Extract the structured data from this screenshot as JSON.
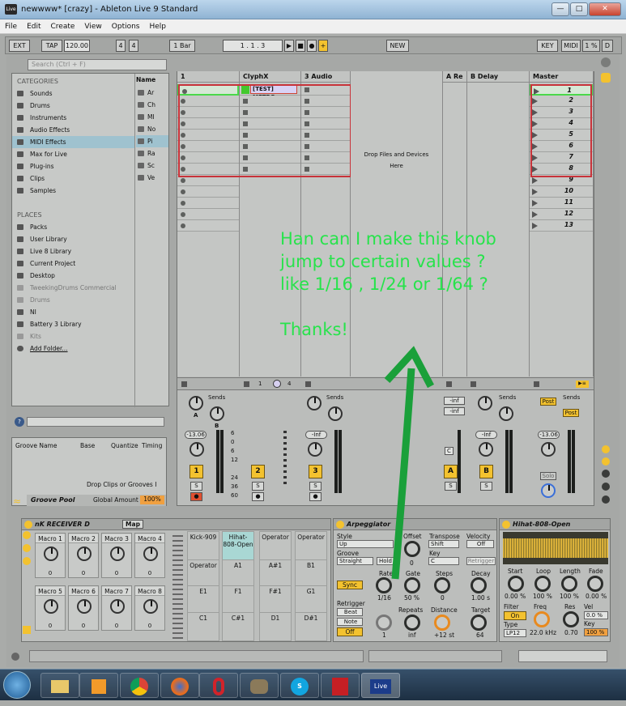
{
  "window": {
    "title": "newwww* [crazy] - Ableton Live 9 Standard",
    "app_icon": "Live",
    "minimize": "—",
    "maximize": "□",
    "close": "✕"
  },
  "menu": [
    "File",
    "Edit",
    "Create",
    "View",
    "Options",
    "Help"
  ],
  "toolbar": {
    "ext": "EXT",
    "tap": "TAP",
    "tempo": "120.00",
    "signature_num": "4",
    "signature_den": "4",
    "quantize": "1 Bar",
    "position": "1 .  1 .  3",
    "new": "NEW",
    "key": "KEY",
    "midi": "MIDI",
    "cpu": "1 %",
    "disk": "D"
  },
  "browser": {
    "search_placeholder": "Search (Ctrl + F)",
    "categories_title": "CATEGORIES",
    "categories": [
      "Sounds",
      "Drums",
      "Instruments",
      "Audio Effects",
      "MIDI Effects",
      "Max for Live",
      "Plug-ins",
      "Clips",
      "Samples"
    ],
    "selected": "MIDI Effects",
    "places_title": "PLACES",
    "places": [
      "Packs",
      "User Library",
      "Live 8 Library",
      "Current Project",
      "Desktop",
      "TweekingDrums Commercial",
      "Drums",
      "NI",
      "Battery 3 Library",
      "Kits",
      "Add Folder..."
    ],
    "name_header": "Name",
    "names": [
      "Ar",
      "Ch",
      "MI",
      "No",
      "Pi",
      "Ra",
      "Sc",
      "Ve"
    ]
  },
  "groove": {
    "headers": [
      "Groove Name",
      "Base",
      "Quantize",
      "Timing"
    ],
    "hint": "Drop Clips or Grooves I",
    "pool": "Groove Pool",
    "global_amount_label": "Global Amount",
    "global_amount": "100%"
  },
  "session": {
    "tracks": [
      {
        "name": "1",
        "number": "1",
        "volume": "-13.06",
        "sends": "Sends"
      },
      {
        "name": "ClyphX",
        "number": "2",
        "clip": "[TEST] METRO"
      },
      {
        "name": "3 Audio",
        "number": "3",
        "volume": "-Inf",
        "sends": "Sends"
      },
      {
        "name": "A Re",
        "number": "A",
        "send1": "-inf",
        "send2": "-inf",
        "c": "C"
      },
      {
        "name": "B Delay",
        "number": "B",
        "volume": "-Inf",
        "sends": "Sends"
      },
      {
        "name": "Master",
        "volume": "-13.06",
        "sends": "Sends",
        "post1": "Post",
        "post2": "Post",
        "solo": "Solo"
      }
    ],
    "drop_text": "Drop Files and Devices Here",
    "scenes": [
      "1",
      "2",
      "3",
      "4",
      "5",
      "6",
      "7",
      "8",
      "9",
      "10",
      "11",
      "12",
      "13"
    ],
    "clyphx_io": [
      "1",
      "4"
    ],
    "send_knob_labels": [
      "A",
      "B"
    ],
    "meter_scale": [
      "6",
      "0",
      "6",
      "12",
      "24",
      "36",
      "60"
    ]
  },
  "devices": {
    "receiver": {
      "title": "nK RECEIVER D",
      "map": "Map",
      "macros": [
        {
          "label": "Macro 1",
          "value": "0"
        },
        {
          "label": "Macro 2",
          "value": "0"
        },
        {
          "label": "Macro 3",
          "value": "0"
        },
        {
          "label": "Macro 4",
          "value": "0"
        },
        {
          "label": "Macro 5",
          "value": "0"
        },
        {
          "label": "Macro 6",
          "value": "0"
        },
        {
          "label": "Macro 7",
          "value": "0"
        },
        {
          "label": "Macro 8",
          "value": "0"
        }
      ],
      "pads": [
        "Kick-909",
        "Hihat-808-Open",
        "Operator",
        "Operator",
        "Operator",
        "A1",
        "A#1",
        "B1",
        "E1",
        "F1",
        "F#1",
        "G1",
        "C1",
        "C#1",
        "D1",
        "D#1"
      ]
    },
    "arpeggiator": {
      "title": "Arpeggiator",
      "style_label": "Style",
      "style": "Up",
      "groove_label": "Groove",
      "groove": "Straight",
      "hold": "Hold",
      "sync": "Sync",
      "rate_label": "Rate",
      "rate": "1/16",
      "offset_label": "Offset",
      "offset": "0",
      "gate_label": "Gate",
      "gate": "50 %",
      "transpose_label": "Transpose",
      "transpose": "Shift",
      "key_label": "Key",
      "key": "C",
      "steps_label": "Steps",
      "steps": "0",
      "velocity_label": "Velocity",
      "velocity": "Off",
      "retrigger_btn": "Retrigger",
      "retrigger_label": "Retrigger",
      "beat": "Beat",
      "note": "Note",
      "off": "Off",
      "repeats_label": "Repeats",
      "repeats": "inf",
      "distance_label": "Distance",
      "distance": "+12 st",
      "decay_label": "Decay",
      "decay": "1.00 s",
      "target_label": "Target",
      "target": "64",
      "extra_value": "1"
    },
    "sampler": {
      "title": "Hihat-808-Open",
      "start_label": "Start",
      "start": "0.00 %",
      "loop_label": "Loop",
      "loop": "100 %",
      "length_label": "Length",
      "length": "100 %",
      "fade_label": "Fade",
      "fade": "0.00 %",
      "filter_label": "Filter",
      "filter": "On",
      "type_label": "Type",
      "type": "LP12",
      "freq_label": "Freq",
      "freq": "22.0 kHz",
      "res_label": "Res",
      "res": "0.70",
      "vel_label": "Vel",
      "vel": "0.0 %",
      "key_label": "Key",
      "key": "100 %"
    }
  },
  "annotation": {
    "lines": [
      "Han can I make this knob",
      "jump to certain values ?",
      "like 1/16 , 1/24 or 1/64 ?",
      "",
      "Thanks!"
    ],
    "color": "#27e34b"
  },
  "taskbar": {
    "items": [
      "start",
      "explorer",
      "media",
      "chrome",
      "firefox",
      "opera",
      "gimp",
      "skype",
      "acrobat",
      "Live"
    ]
  }
}
